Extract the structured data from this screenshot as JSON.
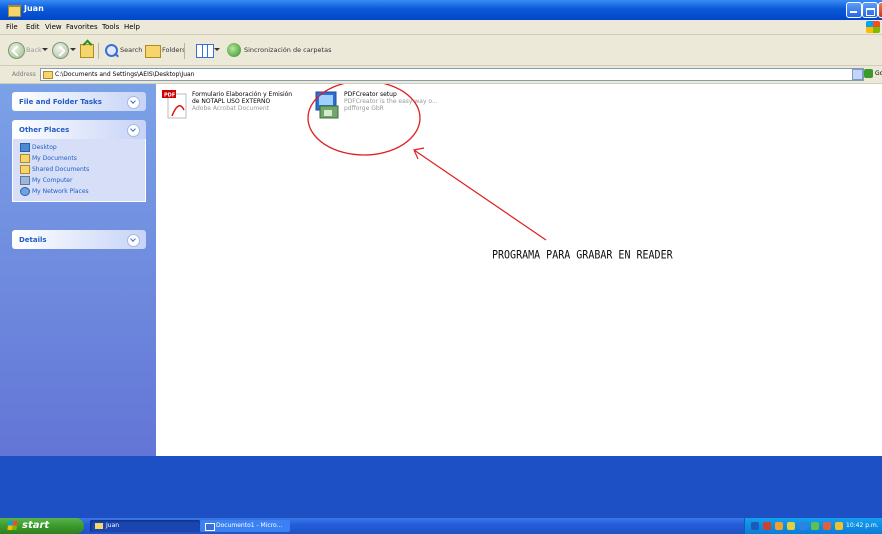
{
  "window": {
    "title": "Juan"
  },
  "menu": [
    "File",
    "Edit",
    "View",
    "Favorites",
    "Tools",
    "Help"
  ],
  "toolbar": {
    "back_label": "Back",
    "search_label": "Search",
    "folders_label": "Folders",
    "sync_label": "Sincronización de carpetas"
  },
  "address": {
    "label": "Address",
    "value": "C:\\Documents and Settings\\AEIS\\Desktop\\Juan",
    "go_label": "Go"
  },
  "sidebar": {
    "file_tasks_title": "File and Folder Tasks",
    "other_places_title": "Other Places",
    "places": [
      {
        "label": "Desktop",
        "icon": "desktop-icon"
      },
      {
        "label": "My Documents",
        "icon": "my-documents-icon"
      },
      {
        "label": "Shared Documents",
        "icon": "shared-documents-icon"
      },
      {
        "label": "My Computer",
        "icon": "my-computer-icon"
      },
      {
        "label": "My Network Places",
        "icon": "network-places-icon"
      }
    ],
    "details_title": "Details"
  },
  "files": [
    {
      "name_line1": "Formulario Elaboración y Emisión",
      "name_line2": "de NOTAPL USO EXTERNO",
      "type": "Adobe Acrobat Document",
      "icon": "pdf-document-icon"
    },
    {
      "name_line1": "PDFCreator setup",
      "name_line2": "PDFCreator is the easy way o...",
      "type": "pdfforge GbR",
      "icon": "installer-icon"
    }
  ],
  "annotation": {
    "text": "PROGRAMA PARA GRABAR EN READER",
    "color": "#e02020"
  },
  "taskbar": {
    "start_label": "start",
    "items": [
      {
        "label": "Juan"
      },
      {
        "label": "Documento1 - Micro..."
      }
    ],
    "clock": "10:42 p.m."
  }
}
